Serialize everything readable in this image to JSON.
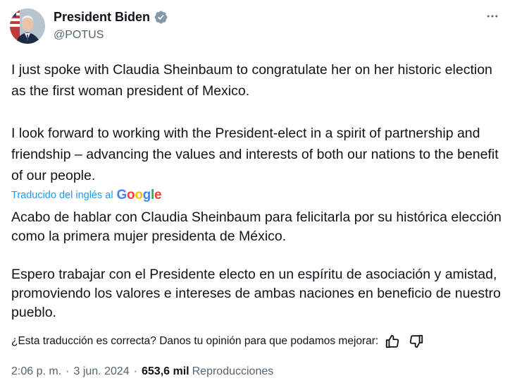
{
  "author": {
    "display_name": "President Biden",
    "handle": "@POTUS",
    "verified_badge": "gray-check-badge"
  },
  "tweet": {
    "paragraphs_original": [
      "I just spoke with Claudia Sheinbaum to congratulate her on her historic election as the first woman president of Mexico.",
      "I look forward to working with the President-elect in a spirit of partnership and friendship – advancing the values and interests of both our nations to the benefit of our people."
    ],
    "translated_label": "Traducido del inglés al",
    "translator_brand": "Google",
    "paragraphs_translated": [
      "Acabo de hablar con Claudia Sheinbaum para felicitarla por su histórica elección como la primera mujer presidenta de México.",
      "Espero trabajar con el Presidente electo en un espíritu de asociación y amistad, promoviendo los valores e intereses de ambas naciones en beneficio de nuestro pueblo."
    ],
    "feedback_prompt": "¿Esta traducción es correcta? Danos tu opinión para que podamos mejorar:"
  },
  "meta": {
    "time": "2:06 p. m.",
    "separator": "·",
    "date": "3 jun. 2024",
    "views_count": "653,6 mil",
    "views_label": "Reproducciones"
  },
  "icons": {
    "more": "more-options-icon",
    "thumbs_up": "thumbs-up-icon",
    "thumbs_down": "thumbs-down-icon"
  },
  "colors": {
    "text_primary": "#0f1419",
    "text_secondary": "#536471",
    "link_blue": "#1d9bf0",
    "verified_gray": "#829aab"
  }
}
